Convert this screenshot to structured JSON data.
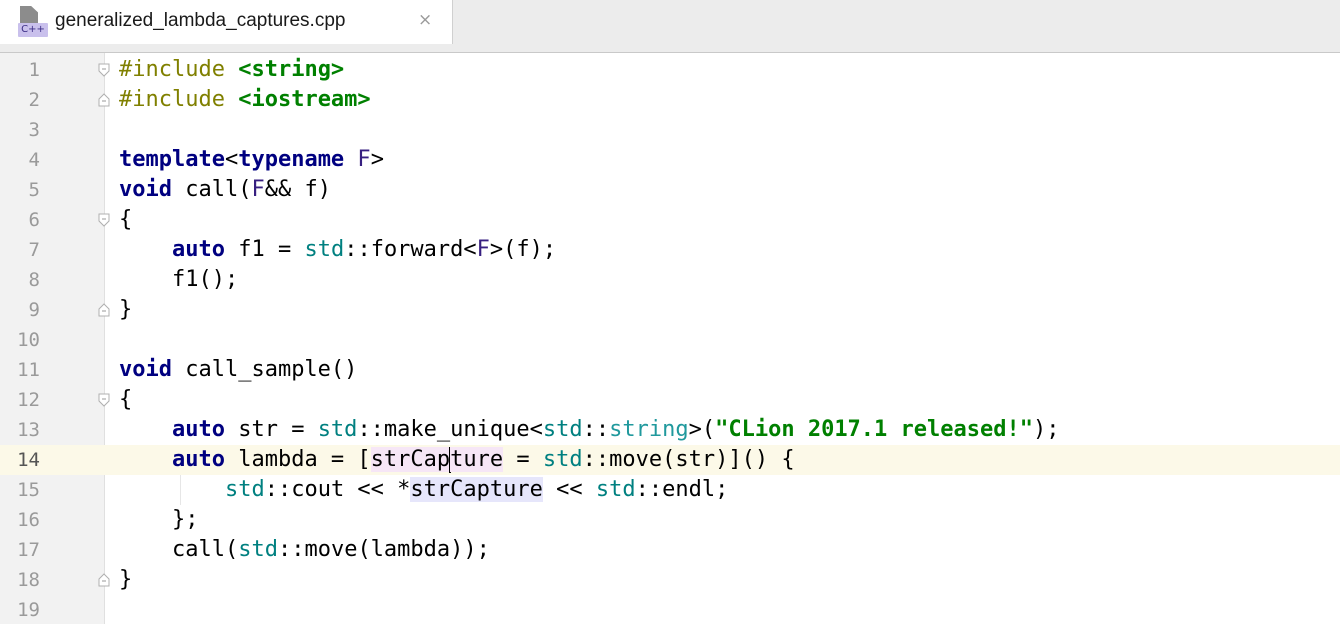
{
  "tab": {
    "file_name": "generalized_lambda_captures.cpp",
    "file_badge": "C++",
    "close_glyph": "×"
  },
  "editor": {
    "current_line": 14,
    "line_numbers": [
      "1",
      "2",
      "3",
      "4",
      "5",
      "6",
      "7",
      "8",
      "9",
      "10",
      "11",
      "12",
      "13",
      "14",
      "15",
      "16",
      "17",
      "18",
      "19"
    ],
    "lines": [
      [
        [
          "pp",
          "#include "
        ],
        [
          "hdr",
          "<string>"
        ]
      ],
      [
        [
          "pp",
          "#include "
        ],
        [
          "hdr",
          "<iostream>"
        ]
      ],
      [],
      [
        [
          "kw",
          "template"
        ],
        [
          "",
          "<"
        ],
        [
          "kw",
          "typename"
        ],
        [
          "tparam",
          " F"
        ],
        [
          "",
          ">"
        ]
      ],
      [
        [
          "kw",
          "void"
        ],
        [
          "",
          " call("
        ],
        [
          "tparam",
          "F"
        ],
        [
          "",
          "&& f)"
        ]
      ],
      [
        [
          "",
          "{"
        ]
      ],
      [
        [
          "",
          "    "
        ],
        [
          "kw",
          "auto"
        ],
        [
          "",
          " f1 = "
        ],
        [
          "ns",
          "std"
        ],
        [
          "",
          "::forward<"
        ],
        [
          "tparam",
          "F"
        ],
        [
          "",
          ">(f);"
        ]
      ],
      [
        [
          "",
          "    f1();"
        ]
      ],
      [
        [
          "",
          "}"
        ]
      ],
      [],
      [
        [
          "kw",
          "void"
        ],
        [
          "",
          " call_sample()"
        ]
      ],
      [
        [
          "",
          "{"
        ]
      ],
      [
        [
          "",
          "    "
        ],
        [
          "kw",
          "auto"
        ],
        [
          "",
          " str = "
        ],
        [
          "ns",
          "std"
        ],
        [
          "",
          "::make_unique<"
        ],
        [
          "ns",
          "std"
        ],
        [
          "",
          "::"
        ],
        [
          "tp",
          "string"
        ],
        [
          "",
          ">("
        ],
        [
          "str",
          "\"CLion 2017.1 released!\""
        ],
        [
          "",
          ");"
        ]
      ],
      [
        [
          "",
          "    "
        ],
        [
          "kw",
          "auto"
        ],
        [
          "",
          " lambda = ["
        ],
        [
          "hl1",
          "strCap"
        ],
        [
          "caret",
          ""
        ],
        [
          "hl1",
          "ture"
        ],
        [
          "",
          " = "
        ],
        [
          "ns",
          "std"
        ],
        [
          "",
          "::move(str)]() {"
        ]
      ],
      [
        [
          "",
          "        "
        ],
        [
          "ns",
          "std"
        ],
        [
          "",
          "::cout << *"
        ],
        [
          "hl2",
          "strCapture"
        ],
        [
          "",
          " << "
        ],
        [
          "ns",
          "std"
        ],
        [
          "",
          "::endl;"
        ]
      ],
      [
        [
          "",
          "    };"
        ]
      ],
      [
        [
          "",
          "    call("
        ],
        [
          "ns",
          "std"
        ],
        [
          "",
          "::move(lambda));"
        ]
      ],
      [
        [
          "",
          "}"
        ]
      ],
      []
    ]
  },
  "colors": {
    "keyword": "#000080",
    "string": "#008000",
    "preprocessor": "#808000",
    "namespace": "#008080",
    "type_param": "#371f80",
    "current_line_bg": "#fcf9e8"
  },
  "icons": [
    "cpp-file-icon",
    "close-tab-icon",
    "fold-marker-icon"
  ]
}
